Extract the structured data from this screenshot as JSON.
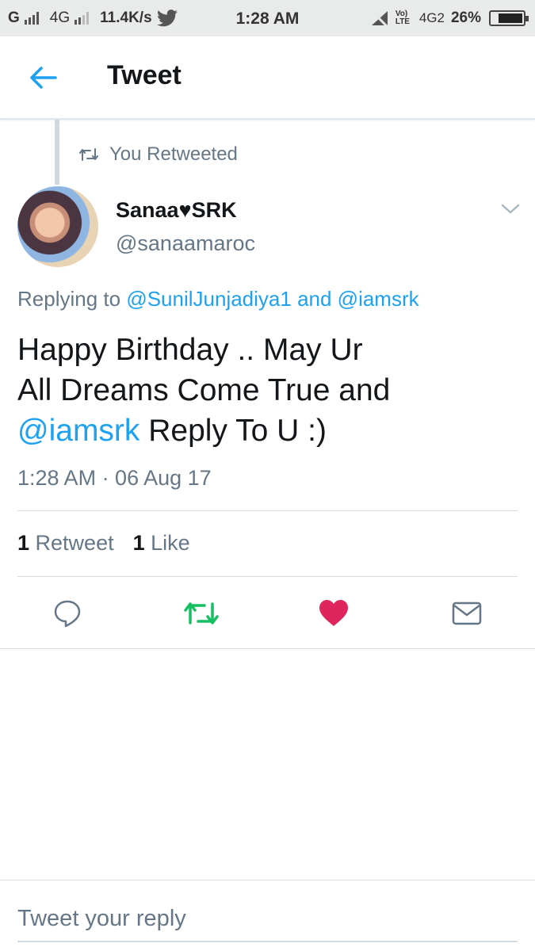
{
  "status_bar": {
    "carrier1": "G",
    "carrier2": "4G",
    "speed": "11.4K/s",
    "time": "1:28 AM",
    "volte": "Vo) LTE",
    "network": "4G2",
    "battery": "26%",
    "battery_level": 0.26
  },
  "header": {
    "title": "Tweet",
    "back_icon": "arrow-left-icon"
  },
  "retweet_context": {
    "label": "You Retweeted",
    "icon": "retweet-icon"
  },
  "tweet": {
    "display_name": "Sanaa♥SRK",
    "handle": "@sanaamaroc",
    "replying_prefix": "Replying to ",
    "replying_user1": "@SunilJunjadiya1",
    "replying_and": " and ",
    "replying_user2": "@iamsrk",
    "text_line1": "Happy Birthday .. May Ur",
    "text_line2": "All Dreams Come True and",
    "text_mention": "@iamsrk",
    "text_line3_rest": " Reply To U :)",
    "timestamp": "1:28 AM · 06 Aug 17"
  },
  "stats": {
    "retweet_count": "1",
    "retweet_label": " Retweet",
    "like_count": "1",
    "like_label": " Like"
  },
  "actions": {
    "reply_icon": "reply-icon",
    "retweet_icon": "retweet-icon",
    "like_icon": "heart-icon",
    "dm_icon": "envelope-icon"
  },
  "colors": {
    "accent": "#1da1f2",
    "retweet_active": "#17bf63",
    "like_active": "#e0245e",
    "secondary_text": "#657786"
  },
  "reply": {
    "placeholder": "Tweet your reply"
  }
}
